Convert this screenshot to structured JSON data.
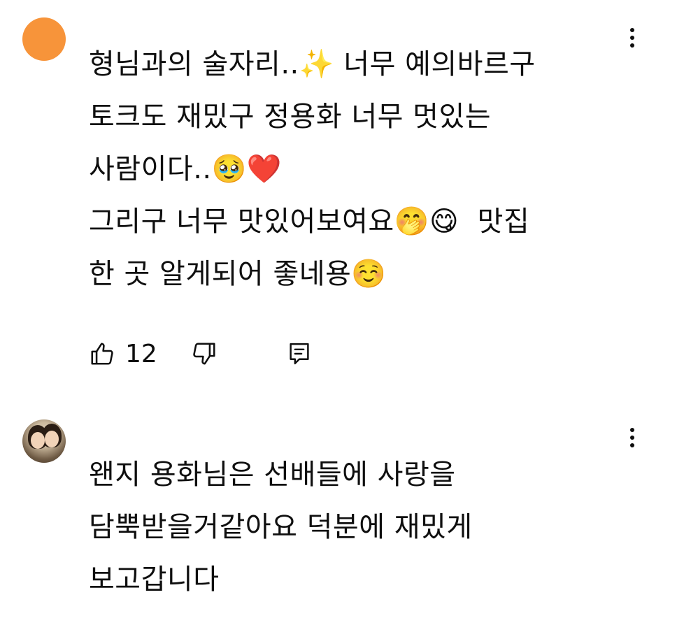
{
  "comments": [
    {
      "avatar_color": "#f7943a",
      "text": "형님과의 술자리..✨ 너무 예의바르구\n토크도 재밌구 정용화 너무 멋있는\n사람이다..🥹❤️\n그리구 너무 맛있어보여요🤭😋  맛집\n한 곳 알게되어 좋네용☺️",
      "like_count": "12",
      "icons": {
        "like": "thumb-up-icon",
        "dislike": "thumb-down-icon",
        "reply": "reply-icon",
        "menu": "more-vert-icon"
      }
    },
    {
      "avatar": "user-photo-avatar",
      "text": "왠지 용화님은 선배들에 사랑을\n담뿍받을거같아요 덕분에 재밌게\n보고갑니다",
      "icons": {
        "menu": "more-vert-icon"
      }
    }
  ]
}
